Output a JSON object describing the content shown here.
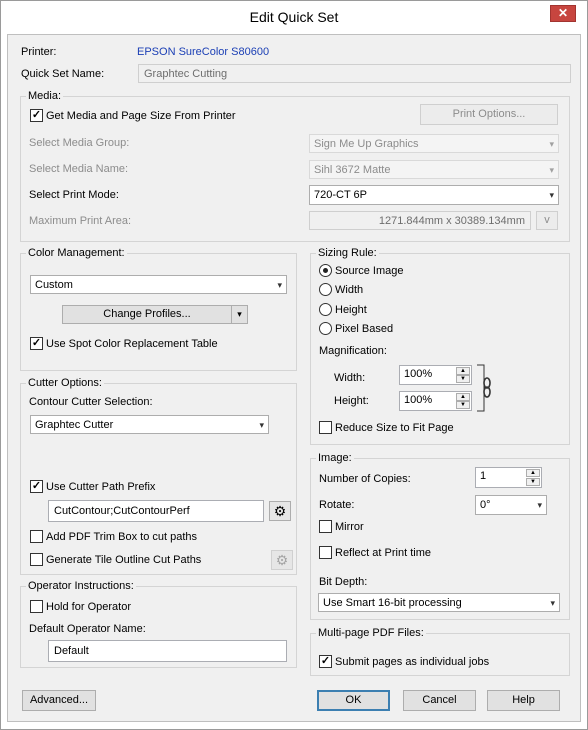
{
  "window": {
    "title": "Edit Quick Set",
    "close": "✕"
  },
  "printer": {
    "label": "Printer:",
    "value": "EPSON SureColor S80600"
  },
  "quickset": {
    "label": "Quick Set Name:",
    "value": "Graphtec Cutting"
  },
  "media": {
    "title": "Media:",
    "get_from_printer": {
      "label": "Get Media and Page Size From Printer",
      "checked": true
    },
    "print_options": "Print Options...",
    "group_label": "Select Media Group:",
    "group_value": "Sign Me Up Graphics",
    "name_label": "Select Media Name:",
    "name_value": "Sihl 3672 Matte",
    "mode_label": "Select Print Mode:",
    "mode_value": "720-CT 6P",
    "area_label": "Maximum Print Area:",
    "area_value": "1271.844mm x 30389.134mm",
    "area_unit": "v"
  },
  "color": {
    "title": "Color Management:",
    "value": "Custom",
    "change_profiles": "Change Profiles...",
    "spot": {
      "label": "Use Spot Color Replacement Table",
      "checked": true
    }
  },
  "cutter": {
    "title": "Cutter Options:",
    "contour_label": "Contour Cutter Selection:",
    "contour_value": "Graphtec Cutter",
    "prefix": {
      "label": "Use Cutter Path Prefix",
      "checked": true
    },
    "prefix_value": "CutContour;CutContourPerf",
    "trim": {
      "label": "Add PDF Trim Box to cut paths",
      "checked": false
    },
    "tile": {
      "label": "Generate Tile Outline Cut Paths",
      "checked": false
    }
  },
  "operator": {
    "title": "Operator Instructions:",
    "hold": {
      "label": "Hold for Operator",
      "checked": false
    },
    "name_label": "Default Operator Name:",
    "name_value": "Default"
  },
  "sizing": {
    "title": "Sizing Rule:",
    "options": [
      "Source Image",
      "Width",
      "Height",
      "Pixel Based"
    ],
    "selected": "Source Image",
    "magnification_label": "Magnification:",
    "width_label": "Width:",
    "width_value": "100%",
    "height_label": "Height:",
    "height_value": "100%",
    "reduce": {
      "label": "Reduce Size to Fit Page",
      "checked": false
    }
  },
  "image": {
    "title": "Image:",
    "copies_label": "Number of Copies:",
    "copies_value": "1",
    "rotate_label": "Rotate:",
    "rotate_value": "0°",
    "mirror": {
      "label": "Mirror",
      "checked": false
    },
    "reflect": {
      "label": "Reflect at Print time",
      "checked": false
    },
    "bitdepth_label": "Bit Depth:",
    "bitdepth_value": "Use Smart 16-bit processing"
  },
  "multipage": {
    "title": "Multi-page PDF Files:",
    "submit": {
      "label": "Submit pages as individual jobs",
      "checked": true
    }
  },
  "buttons": {
    "advanced": "Advanced...",
    "ok": "OK",
    "cancel": "Cancel",
    "help": "Help"
  },
  "icons": {
    "check": "✓",
    "dropdown": "▾",
    "spin_up": "▲",
    "spin_down": "▼",
    "gear": "⚙"
  }
}
